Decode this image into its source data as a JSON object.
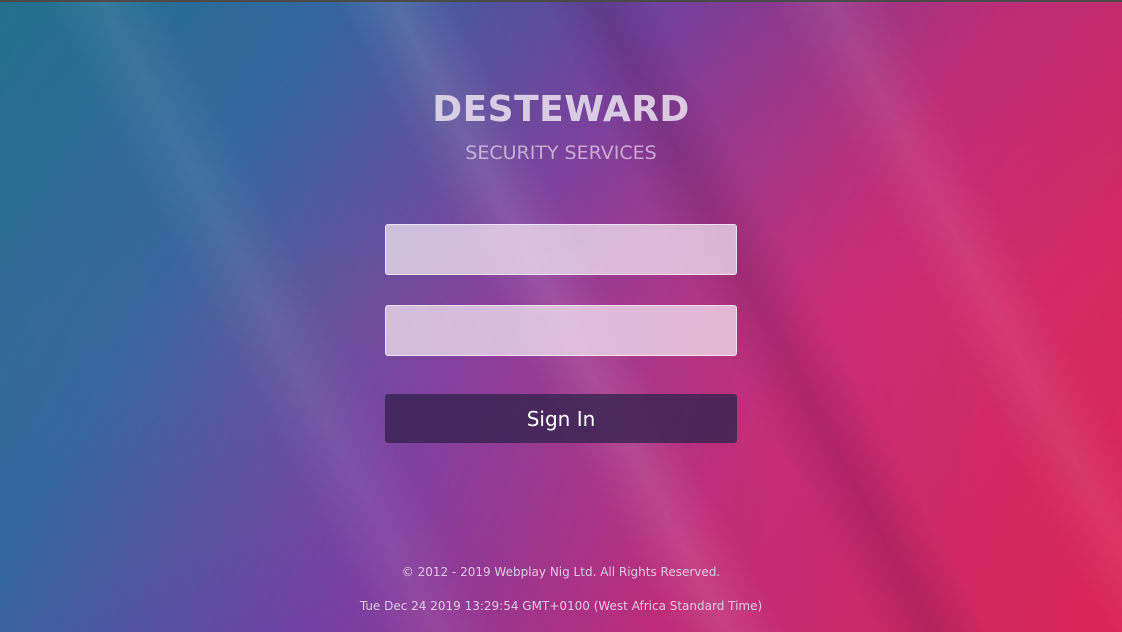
{
  "brand": {
    "title": "DESTEWARD",
    "subtitle": "SECURITY SERVICES"
  },
  "form": {
    "username": {
      "value": "",
      "placeholder": ""
    },
    "password": {
      "value": "",
      "placeholder": ""
    },
    "signin_label": "Sign In"
  },
  "footer": {
    "copyright": "© 2012 - 2019 Webplay Nig Ltd. All Rights Reserved.",
    "datetime": "Tue Dec 24 2019 13:29:54 GMT+0100 (West Africa Standard Time)"
  },
  "colors": {
    "accent_button": "#372350",
    "gradient_left": "#1f738c",
    "gradient_right": "#e6234b"
  }
}
